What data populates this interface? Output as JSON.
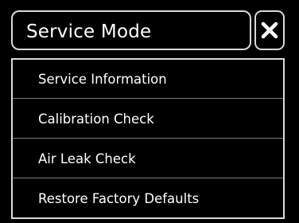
{
  "header": {
    "title": "Service Mode",
    "close_icon": "close-icon"
  },
  "menu": {
    "items": [
      {
        "label": "Service Information"
      },
      {
        "label": "Calibration Check"
      },
      {
        "label": "Air Leak Check"
      },
      {
        "label": "Restore Factory Defaults"
      }
    ]
  },
  "colors": {
    "background": "#000000",
    "text": "#ffffff",
    "border": "#d9d9d9",
    "divider": "#7a7a7a"
  }
}
